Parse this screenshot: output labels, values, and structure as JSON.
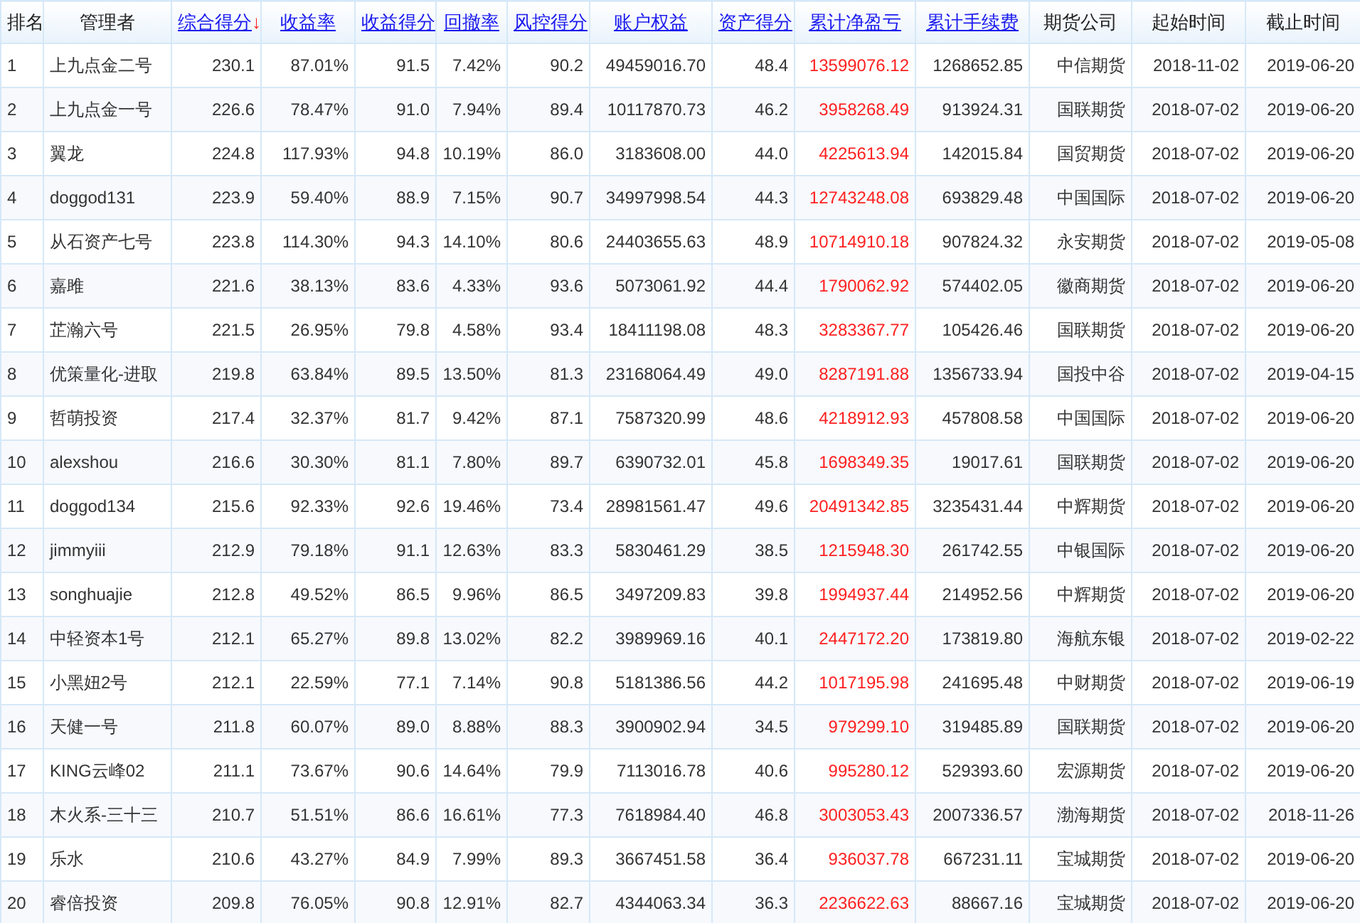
{
  "table": {
    "columns": [
      {
        "label": "排名",
        "kind": "plain"
      },
      {
        "label": "管理者",
        "kind": "plain"
      },
      {
        "label": "综合得分",
        "kind": "link",
        "sort_mark": "↓"
      },
      {
        "label": "收益率",
        "kind": "link"
      },
      {
        "label": "收益得分",
        "kind": "link"
      },
      {
        "label": "回撤率",
        "kind": "link"
      },
      {
        "label": "风控得分",
        "kind": "link"
      },
      {
        "label": "账户权益",
        "kind": "link"
      },
      {
        "label": "资产得分",
        "kind": "link"
      },
      {
        "label": "累计净盈亏",
        "kind": "link",
        "color": "#ff2020"
      },
      {
        "label": "累计手续费",
        "kind": "link"
      },
      {
        "label": "期货公司",
        "kind": "plain"
      },
      {
        "label": "起始时间",
        "kind": "plain"
      },
      {
        "label": "截止时间",
        "kind": "plain"
      }
    ],
    "rows": [
      [
        "1",
        "上九点金二号",
        "230.1",
        "87.01%",
        "91.5",
        "7.42%",
        "90.2",
        "49459016.70",
        "48.4",
        "13599076.12",
        "1268652.85",
        "中信期货",
        "2018-11-02",
        "2019-06-20"
      ],
      [
        "2",
        "上九点金一号",
        "226.6",
        "78.47%",
        "91.0",
        "7.94%",
        "89.4",
        "10117870.73",
        "46.2",
        "3958268.49",
        "913924.31",
        "国联期货",
        "2018-07-02",
        "2019-06-20"
      ],
      [
        "3",
        "翼龙",
        "224.8",
        "117.93%",
        "94.8",
        "10.19%",
        "86.0",
        "3183608.00",
        "44.0",
        "4225613.94",
        "142015.84",
        "国贸期货",
        "2018-07-02",
        "2019-06-20"
      ],
      [
        "4",
        "doggod131",
        "223.9",
        "59.40%",
        "88.9",
        "7.15%",
        "90.7",
        "34997998.54",
        "44.3",
        "12743248.08",
        "693829.48",
        "中国国际",
        "2018-07-02",
        "2019-06-20"
      ],
      [
        "5",
        "从石资产七号",
        "223.8",
        "114.30%",
        "94.3",
        "14.10%",
        "80.6",
        "24403655.63",
        "48.9",
        "10714910.18",
        "907824.32",
        "永安期货",
        "2018-07-02",
        "2019-05-08"
      ],
      [
        "6",
        "嘉雎",
        "221.6",
        "38.13%",
        "83.6",
        "4.33%",
        "93.6",
        "5073061.92",
        "44.4",
        "1790062.92",
        "574402.05",
        "徽商期货",
        "2018-07-02",
        "2019-06-20"
      ],
      [
        "7",
        "芷瀚六号",
        "221.5",
        "26.95%",
        "79.8",
        "4.58%",
        "93.4",
        "18411198.08",
        "48.3",
        "3283367.77",
        "105426.46",
        "国联期货",
        "2018-07-02",
        "2019-06-20"
      ],
      [
        "8",
        "优策量化-进取",
        "219.8",
        "63.84%",
        "89.5",
        "13.50%",
        "81.3",
        "23168064.49",
        "49.0",
        "8287191.88",
        "1356733.94",
        "国投中谷",
        "2018-07-02",
        "2019-04-15"
      ],
      [
        "9",
        "哲萌投资",
        "217.4",
        "32.37%",
        "81.7",
        "9.42%",
        "87.1",
        "7587320.99",
        "48.6",
        "4218912.93",
        "457808.58",
        "中国国际",
        "2018-07-02",
        "2019-06-20"
      ],
      [
        "10",
        "alexshou",
        "216.6",
        "30.30%",
        "81.1",
        "7.80%",
        "89.7",
        "6390732.01",
        "45.8",
        "1698349.35",
        "19017.61",
        "国联期货",
        "2018-07-02",
        "2019-06-20"
      ],
      [
        "11",
        "doggod134",
        "215.6",
        "92.33%",
        "92.6",
        "19.46%",
        "73.4",
        "28981561.47",
        "49.6",
        "20491342.85",
        "3235431.44",
        "中辉期货",
        "2018-07-02",
        "2019-06-20"
      ],
      [
        "12",
        "jimmyiii",
        "212.9",
        "79.18%",
        "91.1",
        "12.63%",
        "83.3",
        "5830461.29",
        "38.5",
        "1215948.30",
        "261742.55",
        "中银国际",
        "2018-07-02",
        "2019-06-20"
      ],
      [
        "13",
        "songhuajie",
        "212.8",
        "49.52%",
        "86.5",
        "9.96%",
        "86.5",
        "3497209.83",
        "39.8",
        "1994937.44",
        "214952.56",
        "中辉期货",
        "2018-07-02",
        "2019-06-20"
      ],
      [
        "14",
        "中轻资本1号",
        "212.1",
        "65.27%",
        "89.8",
        "13.02%",
        "82.2",
        "3989969.16",
        "40.1",
        "2447172.20",
        "173819.80",
        "海航东银",
        "2018-07-02",
        "2019-02-22"
      ],
      [
        "15",
        "小黑妞2号",
        "212.1",
        "22.59%",
        "77.1",
        "7.14%",
        "90.8",
        "5181386.56",
        "44.2",
        "1017195.98",
        "241695.48",
        "中财期货",
        "2018-07-02",
        "2019-06-19"
      ],
      [
        "16",
        "天健一号",
        "211.8",
        "60.07%",
        "89.0",
        "8.88%",
        "88.3",
        "3900902.94",
        "34.5",
        "979299.10",
        "319485.89",
        "国联期货",
        "2018-07-02",
        "2019-06-20"
      ],
      [
        "17",
        "KING云峰02",
        "211.1",
        "73.67%",
        "90.6",
        "14.64%",
        "79.9",
        "7113016.78",
        "40.6",
        "995280.12",
        "529393.60",
        "宏源期货",
        "2018-07-02",
        "2019-06-20"
      ],
      [
        "18",
        "木火系-三十三",
        "210.7",
        "51.51%",
        "86.6",
        "16.61%",
        "77.3",
        "7618984.40",
        "46.8",
        "3003053.43",
        "2007336.57",
        "渤海期货",
        "2018-07-02",
        "2018-11-26"
      ],
      [
        "19",
        "乐水",
        "210.6",
        "43.27%",
        "84.9",
        "7.99%",
        "89.3",
        "3667451.58",
        "36.4",
        "936037.78",
        "667231.11",
        "宝城期货",
        "2018-07-02",
        "2019-06-20"
      ],
      [
        "20",
        "睿倍投资",
        "209.8",
        "76.05%",
        "90.8",
        "12.91%",
        "82.7",
        "4344063.34",
        "36.3",
        "2236622.63",
        "88667.16",
        "宝城期货",
        "2018-07-02",
        "2019-06-20"
      ]
    ]
  }
}
